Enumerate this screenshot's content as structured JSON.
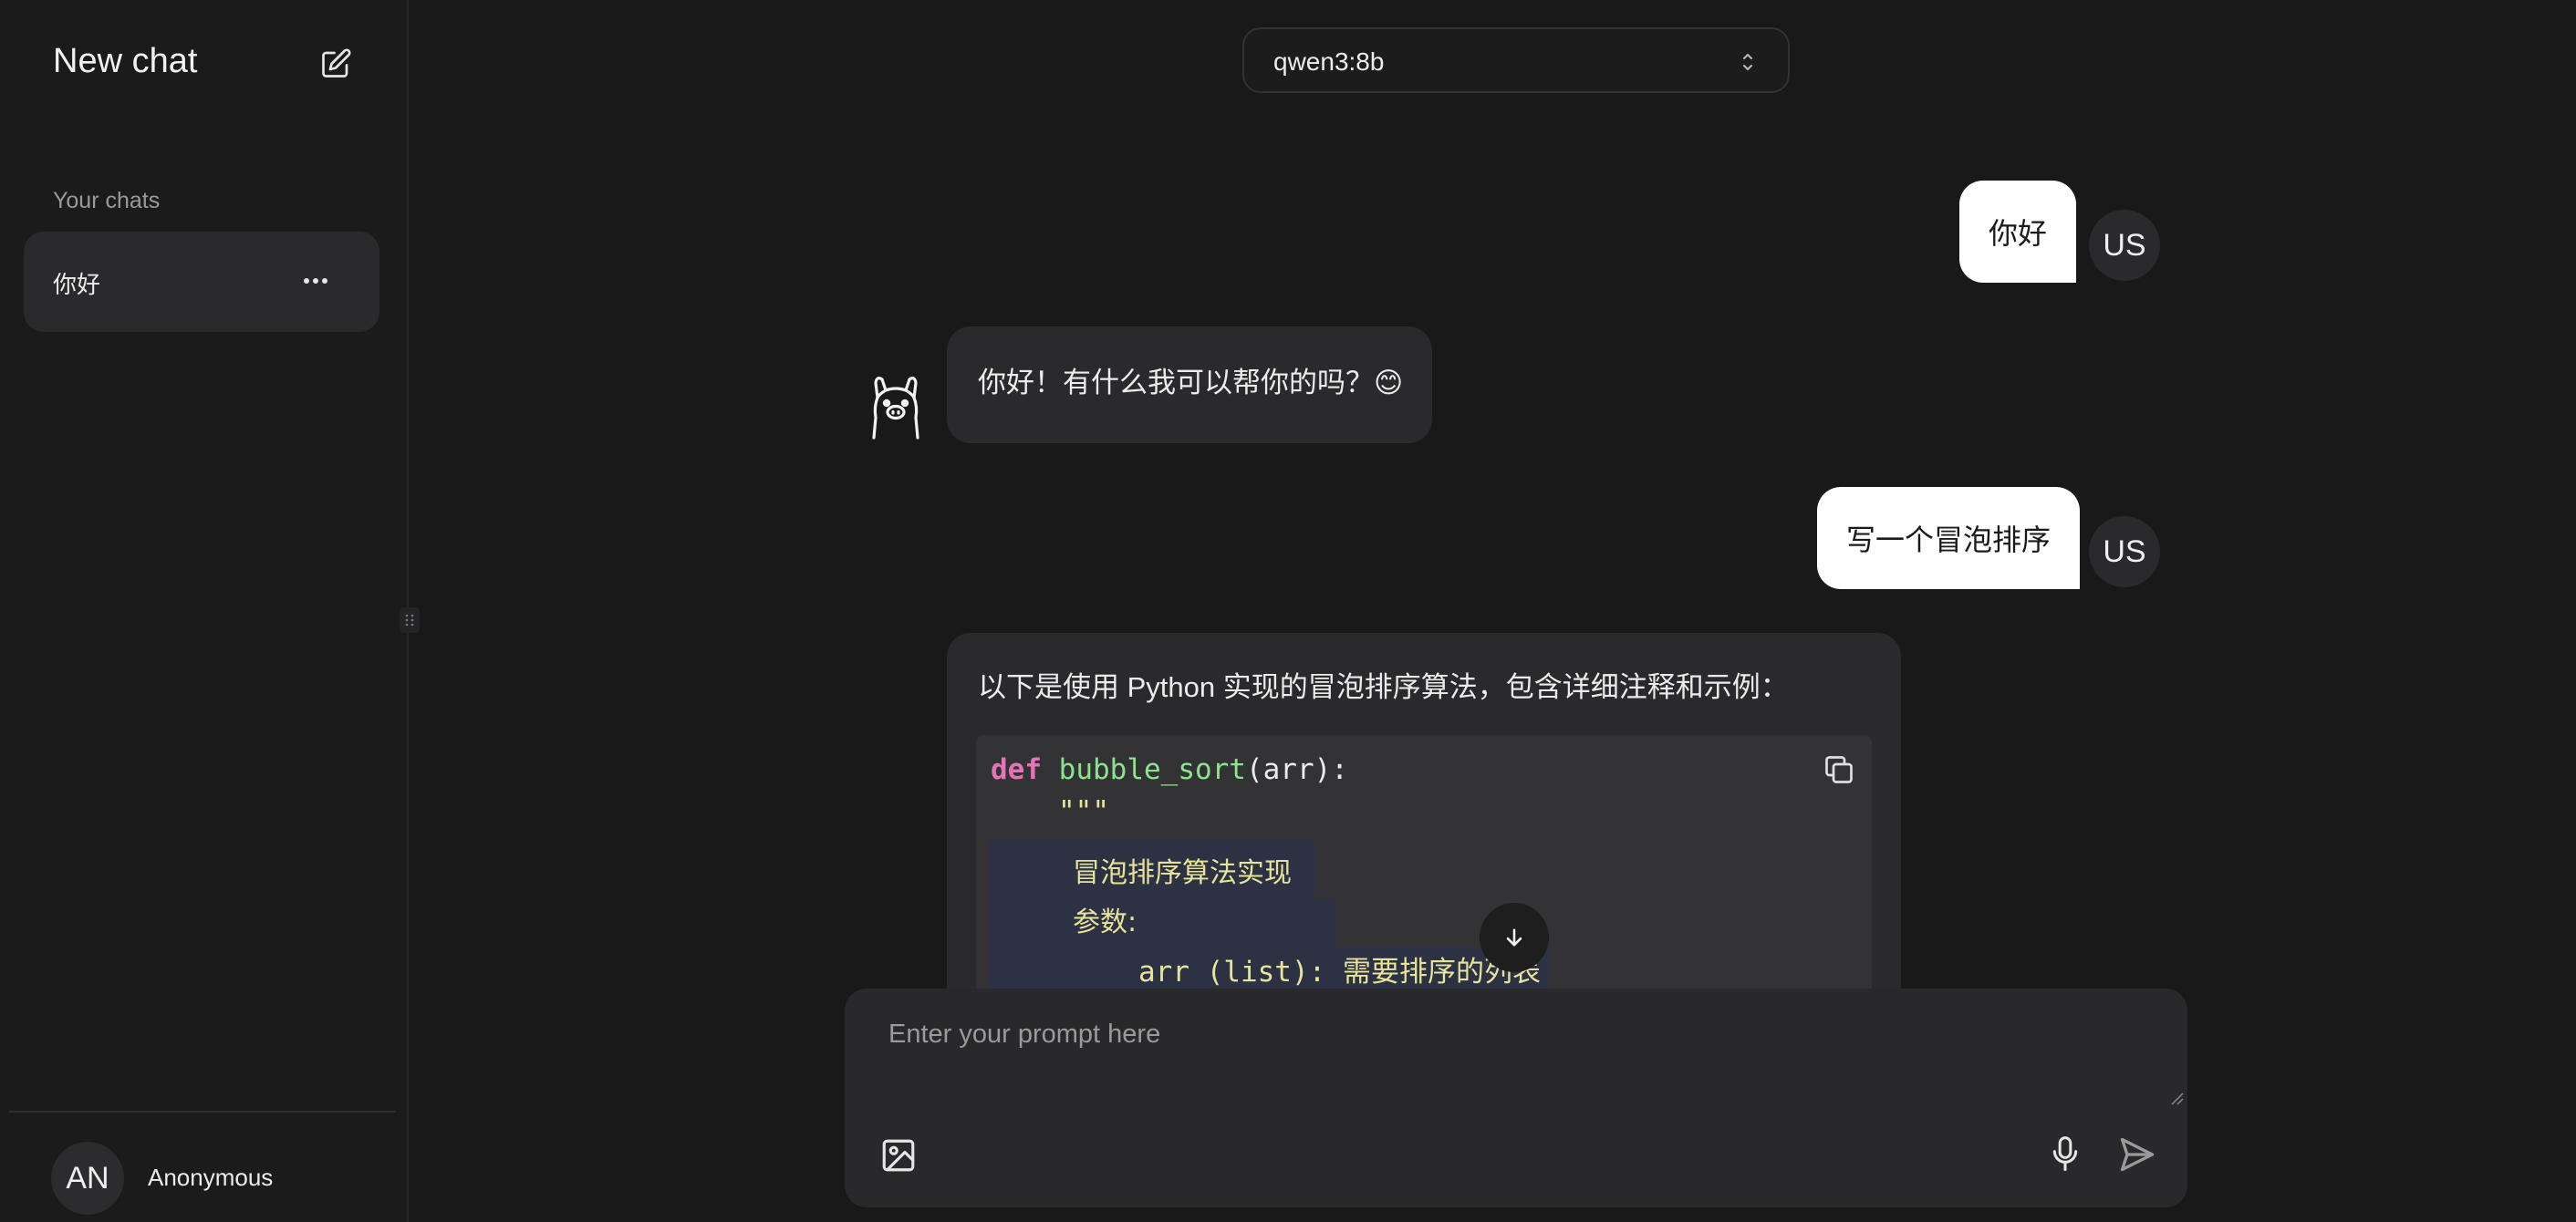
{
  "sidebar": {
    "title": "New chat",
    "section_label": "Your chats",
    "chats": [
      {
        "label": "你好"
      }
    ],
    "user": {
      "initials": "AN",
      "name": "Anonymous"
    }
  },
  "model_selector": {
    "selected": "qwen3:8b"
  },
  "messages": [
    {
      "role": "user",
      "avatar": "US",
      "text": "你好"
    },
    {
      "role": "assistant",
      "text": "你好！有什么我可以帮你的吗？😊"
    },
    {
      "role": "user",
      "avatar": "US",
      "text": "写一个冒泡排序"
    },
    {
      "role": "assistant",
      "text": "以下是使用 Python 实现的冒泡排序算法，包含详细注释和示例：",
      "code": {
        "keyword": "def",
        "function": "bubble_sort",
        "signature_rest": "(arr):",
        "docstring_open": "\"\"\"",
        "doc_line1": "冒泡排序算法实现",
        "doc_line2": "参数:",
        "doc_line3": "arr (list): 需要排序的列表"
      }
    }
  ],
  "composer": {
    "placeholder": "Enter your prompt here"
  },
  "icons": {
    "new_chat": "edit-icon",
    "more": "more-horizontal-icon",
    "chevron": "chevron-up-down-icon",
    "copy": "copy-icon",
    "scroll": "arrow-down-icon",
    "image": "image-icon",
    "mic": "microphone-icon",
    "send": "send-icon"
  }
}
